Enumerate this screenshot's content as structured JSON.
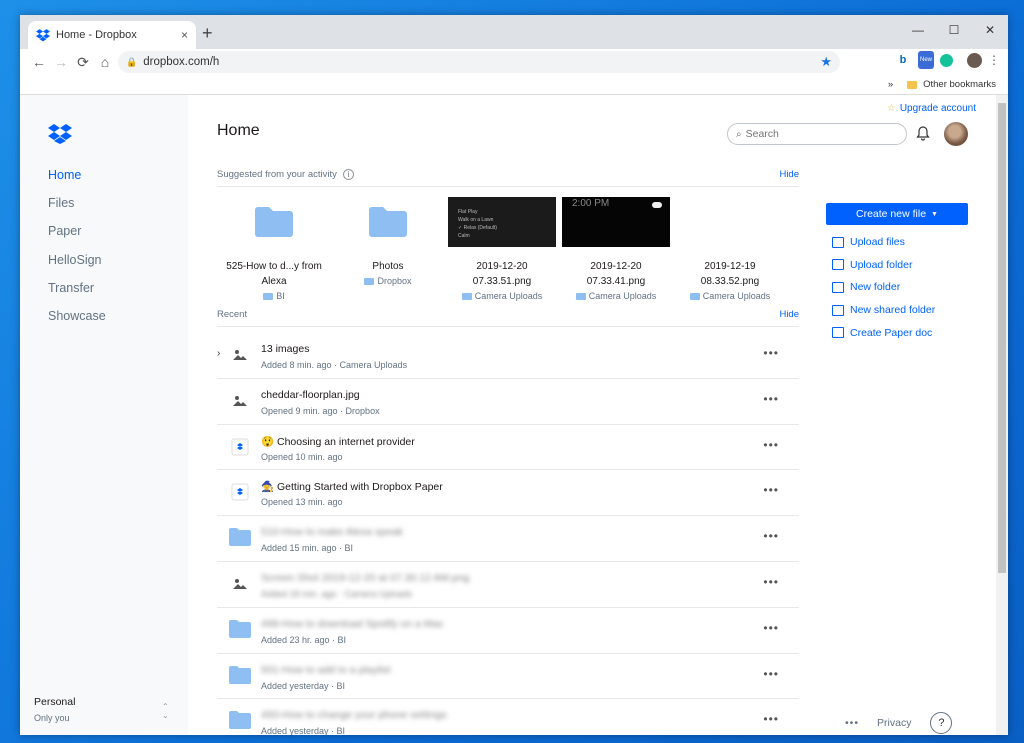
{
  "browser": {
    "tab_title": "Home - Dropbox",
    "tab_close": "×",
    "new_tab": "+",
    "url": "dropbox.com/h",
    "window_controls": [
      "—",
      "☐",
      "✕"
    ],
    "bookmarks_overflow": "»",
    "other_bookmarks": "Other bookmarks",
    "extension_badge": "New"
  },
  "sidebar": {
    "items": [
      {
        "label": "Home",
        "active": true
      },
      {
        "label": "Files"
      },
      {
        "label": "Paper"
      },
      {
        "label": "HelloSign"
      },
      {
        "label": "Transfer"
      },
      {
        "label": "Showcase"
      }
    ],
    "account_name": "Personal",
    "account_sub": "Only you"
  },
  "header": {
    "title": "Home",
    "upgrade": "Upgrade account",
    "search_placeholder": "Search"
  },
  "suggested": {
    "label": "Suggested from your activity",
    "hide": "Hide",
    "items": [
      {
        "name1": "525-How to d...y from",
        "name2": "Alexa",
        "location": "BI",
        "kind": "folder"
      },
      {
        "name1": "Photos",
        "name2": "",
        "location": "Dropbox",
        "kind": "folder"
      },
      {
        "name1": "2019-12-20",
        "name2": "07.33.51.png",
        "location": "Camera Uploads",
        "kind": "shot1"
      },
      {
        "name1": "2019-12-20",
        "name2": "07.33.41.png",
        "location": "Camera Uploads",
        "kind": "shot2"
      },
      {
        "name1": "2019-12-19",
        "name2": "08.33.52.png",
        "location": "Camera Uploads",
        "kind": "none"
      }
    ]
  },
  "recent": {
    "label": "Recent",
    "hide": "Hide",
    "rows": [
      {
        "name": "13 images",
        "meta": "Added 8 min. ago · Camera Uploads",
        "icon": "image",
        "chevron": true,
        "blur": false
      },
      {
        "name": "cheddar-floorplan.jpg",
        "meta": "Opened 9 min. ago · Dropbox",
        "icon": "image",
        "blur": false
      },
      {
        "name": "😲 Choosing an internet provider",
        "meta": "Opened 10 min. ago",
        "icon": "paper",
        "blur": false
      },
      {
        "name": "🧙 Getting Started with Dropbox Paper",
        "meta": "Opened 13 min. ago",
        "icon": "paper",
        "blur": false
      },
      {
        "name": "510-How to make Alexa speak",
        "meta": "Added 15 min. ago · BI",
        "icon": "folder",
        "blur": true,
        "blur_name": true
      },
      {
        "name": "Screen Shot 2019-12-20 at 07.30.12 AM.png",
        "meta": "Added 18 min. ago · Camera Uploads",
        "icon": "image",
        "blur": true,
        "blur_name": true,
        "blur_meta": true
      },
      {
        "name": "499-How to download Spotify on a Mac",
        "meta": "Added 23 hr. ago · BI",
        "icon": "folder",
        "blur": true,
        "blur_name": true
      },
      {
        "name": "501-How to add to a playlist",
        "meta": "Added yesterday · BI",
        "icon": "folder",
        "blur": true,
        "blur_name": true
      },
      {
        "name": "493-How to change your phone settings",
        "meta": "Added yesterday · BI",
        "icon": "folder",
        "blur": true,
        "blur_name": true
      }
    ],
    "more": "•••"
  },
  "right_panel": {
    "create_new_file": "Create new file",
    "actions": [
      "Upload files",
      "Upload folder",
      "New folder",
      "New shared folder",
      "Create Paper doc"
    ]
  },
  "footer": {
    "more": "•••",
    "privacy": "Privacy",
    "help": "?"
  },
  "colors": {
    "accent": "#0061fe",
    "folder": "#8fbef2",
    "sidebar_bg": "#f7f9fa"
  }
}
